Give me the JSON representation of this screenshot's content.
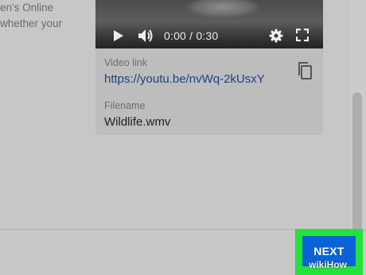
{
  "left_text": [
    "en's Online",
    "whether your"
  ],
  "video": {
    "time": "0:00 / 0:30",
    "play_icon": "play-icon",
    "volume_icon": "volume-icon",
    "settings_icon": "gear-icon",
    "fullscreen_icon": "fullscreen-icon"
  },
  "details": {
    "video_link_label": "Video link",
    "video_link": "https://youtu.be/nvWq-2kUsxY",
    "copy_icon": "copy-icon",
    "filename_label": "Filename",
    "filename": "Wildlife.wmv"
  },
  "footer": {
    "next_label": "NEXT",
    "highlight_color": "#21e33a",
    "button_color": "#0a63d6"
  },
  "watermark": "wikiHow"
}
